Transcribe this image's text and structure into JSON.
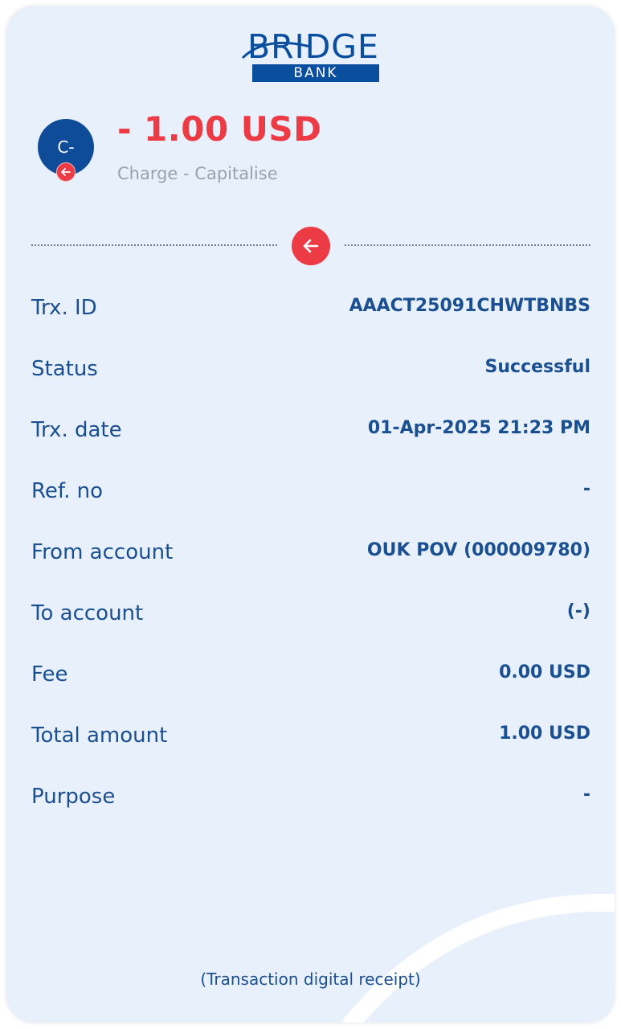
{
  "brand": {
    "name_top": "BRIDGE",
    "name_bottom": "BANK",
    "primary_color": "#0a4ea0",
    "accent_color": "#ec3b45"
  },
  "transaction": {
    "avatar_initials": "C-",
    "amount": "- 1.00 USD",
    "type": "Charge - Capitalise",
    "badge_icon": "arrow-left-icon"
  },
  "details": [
    {
      "label": "Trx. ID",
      "value": "AAACT25091CHWTBNBS"
    },
    {
      "label": "Status",
      "value": "Successful"
    },
    {
      "label": "Trx. date",
      "value": "01-Apr-2025 21:23 PM"
    },
    {
      "label": "Ref. no",
      "value": "-"
    },
    {
      "label": "From account",
      "value": "OUK POV (000009780)"
    },
    {
      "label": "To account",
      "value": "(-)"
    },
    {
      "label": "Fee",
      "value": "0.00 USD"
    },
    {
      "label": "Total amount",
      "value": "1.00 USD"
    },
    {
      "label": "Purpose",
      "value": "-"
    }
  ],
  "footer": {
    "text": "(Transaction digital receipt)"
  }
}
